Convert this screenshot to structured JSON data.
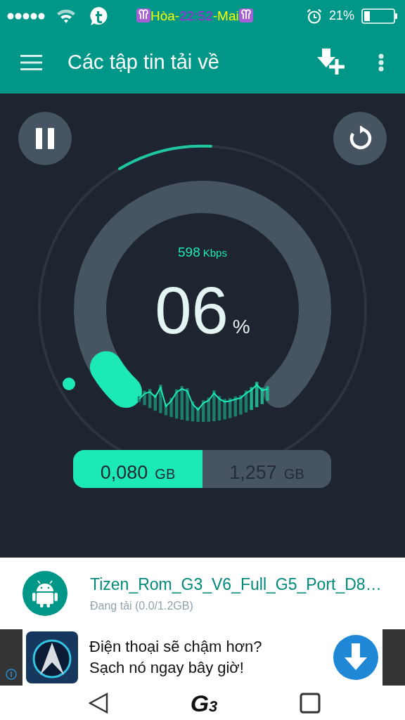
{
  "status_bar": {
    "clock_prefix": "Hòa-",
    "clock_time": "22:52",
    "clock_suffix": "-Mai",
    "battery_percent": "21%"
  },
  "app_bar": {
    "title": "Các tập tin tải về"
  },
  "gauge": {
    "speed": "598",
    "speed_unit": "Kbps",
    "percent": "06",
    "percent_sign": "%"
  },
  "storage": {
    "downloaded": "0,080",
    "downloaded_unit": "GB",
    "total": "1,257",
    "total_unit": "GB"
  },
  "download": {
    "name": "Tizen_Rom_G3_V6_Full_G5_Port_D8…",
    "status": "Đang tải (0.0/1.2GB)"
  },
  "ad": {
    "lines": [
      "Điện thoại sẽ chậm hơn?",
      "Sạch nó ngay bây giờ!"
    ]
  },
  "nav_bar": {
    "logo_letter": "G",
    "logo_digit": "3"
  }
}
